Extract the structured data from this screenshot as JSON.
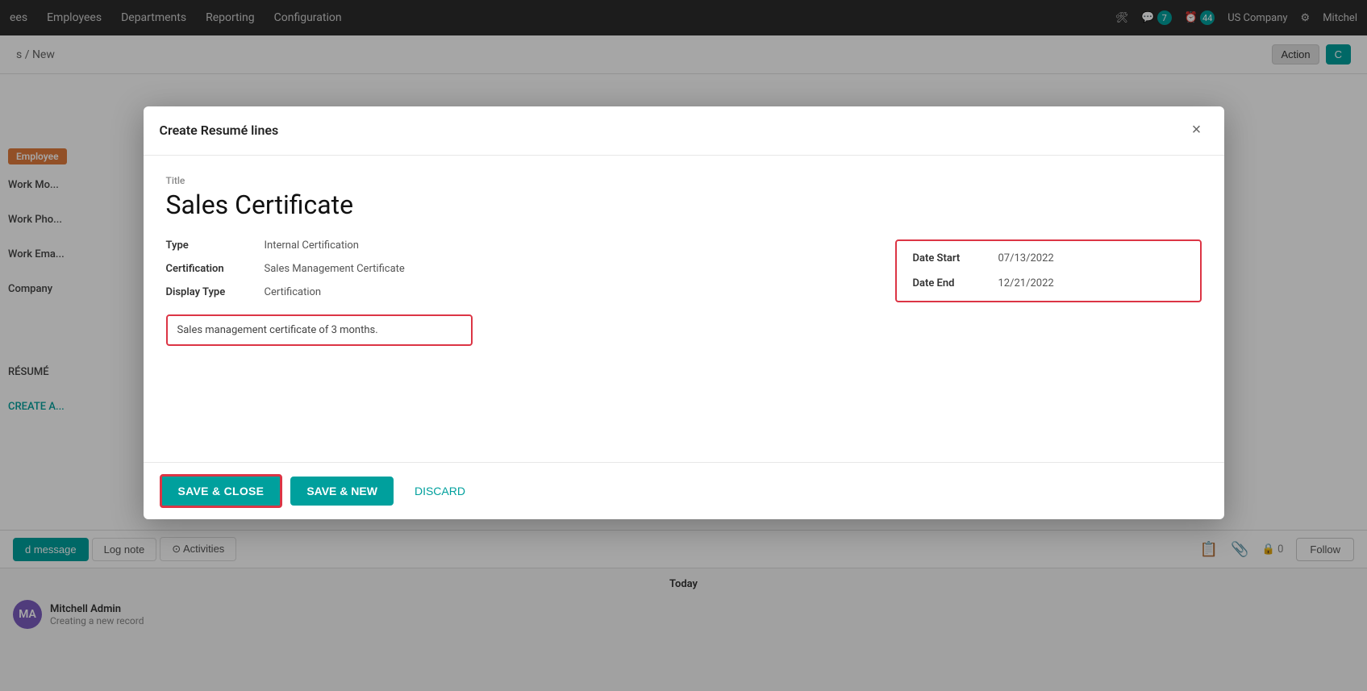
{
  "topnav": {
    "items": [
      "ees",
      "Employees",
      "Departments",
      "Reporting",
      "Configuration"
    ],
    "badge1_count": "7",
    "badge2_count": "44",
    "company": "US Company",
    "user": "Mitchel"
  },
  "breadcrumb": {
    "text": "s / New"
  },
  "action_button": {
    "label": "Action"
  },
  "background": {
    "employee_badge": "Employee",
    "work_mobile_label": "Work Mo...",
    "work_phone_label": "Work Pho...",
    "work_email_label": "Work Ema...",
    "company_label": "Company",
    "resume_label": "RÉSUMÉ",
    "create_a_label": "CREATE A..."
  },
  "modal": {
    "title": "Create Resumé lines",
    "close_label": "×",
    "title_field_label": "Title",
    "title_value": "Sales Certificate",
    "type_label": "Type",
    "type_value": "Internal Certification",
    "certification_label": "Certification",
    "certification_value": "Sales Management Certificate",
    "display_type_label": "Display Type",
    "display_type_value": "Certification",
    "description_text": "Sales management certificate of 3 months.",
    "date_start_label": "Date Start",
    "date_start_value": "07/13/2022",
    "date_end_label": "Date End",
    "date_end_value": "12/21/2022",
    "save_close_label": "SAVE & CLOSE",
    "save_new_label": "SAVE & NEW",
    "discard_label": "DISCARD"
  },
  "chatter": {
    "send_message_label": "d message",
    "log_note_label": "Log note",
    "activities_label": "Activities",
    "follow_label": "Follow",
    "followers_count": "0",
    "today_label": "Today",
    "user_name": "Mitchell Admin",
    "user_action": "Creating a new record",
    "user_initials": "MA"
  }
}
